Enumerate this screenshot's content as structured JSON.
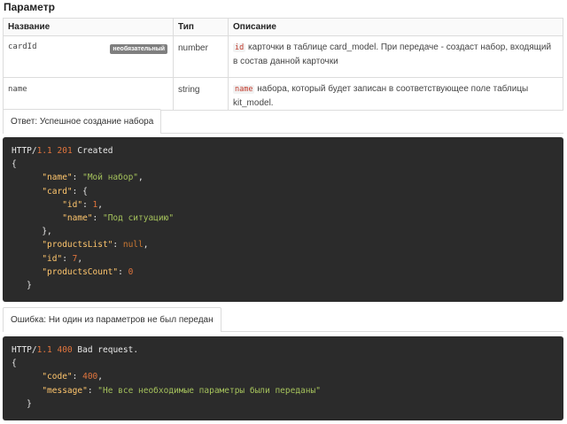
{
  "section_title": "Параметр",
  "table": {
    "headers": [
      "Название",
      "Тип",
      "Описание"
    ],
    "rows": [
      {
        "name": "cardId",
        "badge": "необязательный",
        "type": "number",
        "desc_code": "id",
        "desc_text": "карточки в таблице card_model. При передаче - создаст набор, входящий в состав данной карточки"
      },
      {
        "name": "name",
        "badge": "",
        "type": "string",
        "desc_code": "name",
        "desc_text": "набора, который будет записан в соответствующее поле таблицы kit_model."
      }
    ]
  },
  "response_success": {
    "tab_label": "Ответ: Успешное создание набора",
    "status_line": {
      "proto": "HTTP/",
      "version": "1.1",
      "code": "201",
      "text": "Created"
    },
    "body": {
      "name_key": "\"name\"",
      "name_val": "\"Мой набор\"",
      "card_key": "\"card\"",
      "id_key": "\"id\"",
      "card_id_val": "1",
      "card_name_key": "\"name\"",
      "card_name_val": "\"Под ситуацию\"",
      "products_list_key": "\"productsList\"",
      "products_list_val": "null",
      "id2_key": "\"id\"",
      "id2_val": "7",
      "products_count_key": "\"productsCount\"",
      "products_count_val": "0"
    }
  },
  "response_error": {
    "tab_label": "Ошибка: Ни один из параметров не был передан",
    "status_line": {
      "proto": "HTTP/",
      "version": "1.1",
      "code": "400",
      "text": "Bad request."
    },
    "body": {
      "code_key": "\"code\"",
      "code_val": "400",
      "message_key": "\"message\"",
      "message_val": "\"Не все необходимые параметры были переданы\""
    }
  }
}
